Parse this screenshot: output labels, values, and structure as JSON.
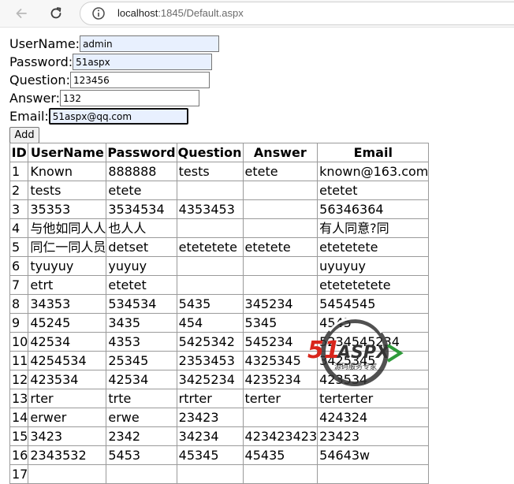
{
  "browser": {
    "url_host": "localhost",
    "url_rest": ":1845/Default.aspx"
  },
  "form": {
    "fields": [
      {
        "label": "UserName:",
        "value": "admin"
      },
      {
        "label": "Password:",
        "value": "51aspx"
      },
      {
        "label": "Question:",
        "value": "123456"
      },
      {
        "label": "Answer:",
        "value": "132"
      },
      {
        "label": "Email:",
        "value": "51aspx@qq.com"
      }
    ],
    "add_label": "Add"
  },
  "table": {
    "headers": [
      "ID",
      "UserName",
      "Password",
      "Question",
      "Answer",
      "Email"
    ],
    "rows": [
      [
        "1",
        "Known",
        "888888",
        "tests",
        "etete",
        "known@163.com"
      ],
      [
        "2",
        "tests",
        "etete",
        "",
        "",
        "etetet"
      ],
      [
        "3",
        "35353",
        "3534534",
        "4353453",
        "",
        "56346364"
      ],
      [
        "4",
        "与他如同人人",
        "也人人",
        "",
        "",
        "有人同意?同"
      ],
      [
        "5",
        "同仁一同人员",
        "detset",
        "etetetete",
        "etetete",
        "etetetete"
      ],
      [
        "6",
        "tyuyuy",
        "yuyuy",
        "",
        "",
        "uyuyuy"
      ],
      [
        "7",
        "etrt",
        "etetet",
        "",
        "",
        "etetetetete"
      ],
      [
        "8",
        "34353",
        "534534",
        "5435",
        "345234",
        "5454545"
      ],
      [
        "9",
        "45245",
        "3435",
        "454",
        "5345",
        "4545"
      ],
      [
        "10",
        "42534",
        "4353",
        "5425342",
        "545234",
        "5234545234"
      ],
      [
        "11",
        "4254534",
        "25345",
        "2353453",
        "4325345",
        "3425345"
      ],
      [
        "12",
        "423534",
        "42534",
        "3425234",
        "4235234",
        "423534"
      ],
      [
        "13",
        "rter",
        "trte",
        "rtrter",
        "terter",
        "terterter"
      ],
      [
        "14",
        "erwer",
        "erwe",
        "23423",
        "",
        "424324"
      ],
      [
        "15",
        "3423",
        "2342",
        "34234",
        "423423423",
        "23423"
      ],
      [
        "16",
        "2343532",
        "5453",
        "45345",
        "45435",
        "54643w"
      ],
      [
        "17",
        "",
        "",
        "",
        "",
        ""
      ]
    ]
  },
  "watermark": {
    "brand": "51ASPX",
    "tagline": "源码服务专家",
    "colors": {
      "red": "#d9261c",
      "green": "#2e9a3a",
      "dark": "#333333"
    }
  }
}
